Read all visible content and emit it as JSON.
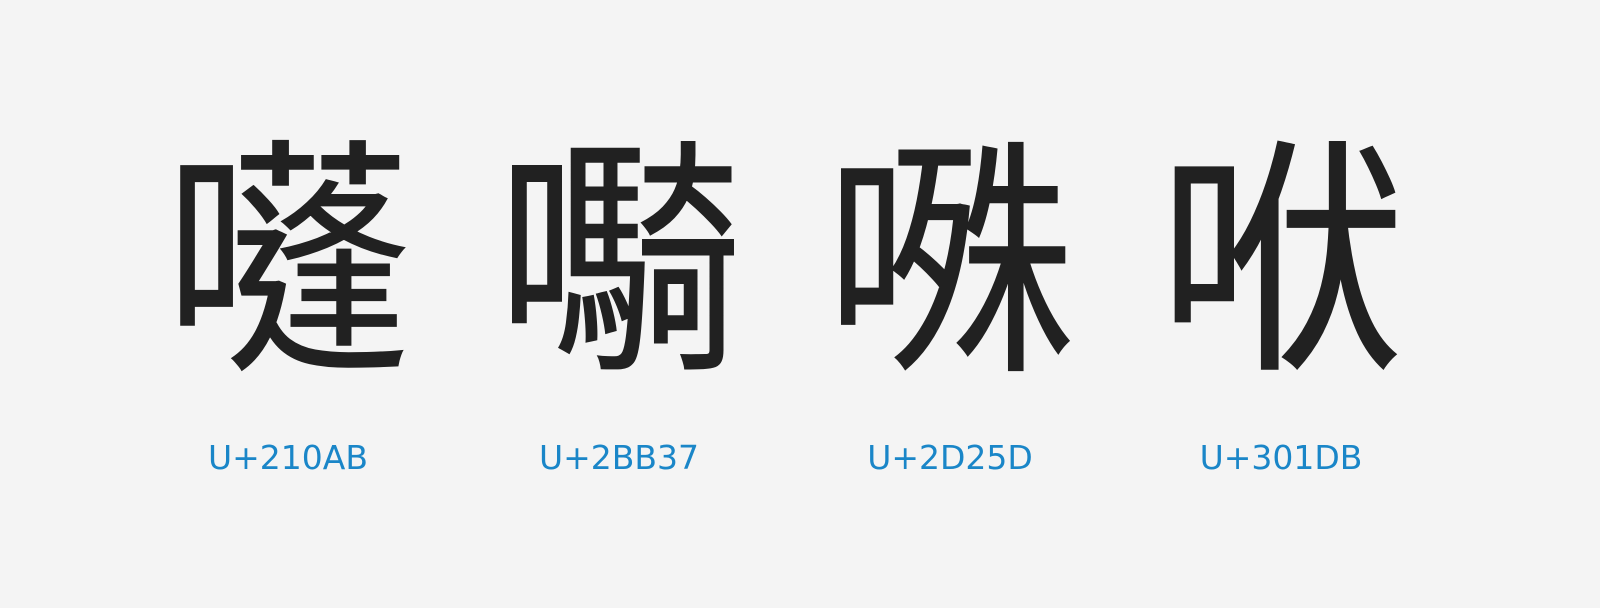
{
  "characters": [
    {
      "glyph": "𡂫",
      "codepoint": "U+210AB"
    },
    {
      "glyph": "𫬷",
      "codepoint": "U+2BB37"
    },
    {
      "glyph": "𭉝",
      "codepoint": "U+2D25D"
    },
    {
      "glyph": "𰇛",
      "codepoint": "U+301DB"
    }
  ],
  "colors": {
    "background": "#f4f4f4",
    "glyph": "#212121",
    "codepoint": "#1a86c8"
  }
}
